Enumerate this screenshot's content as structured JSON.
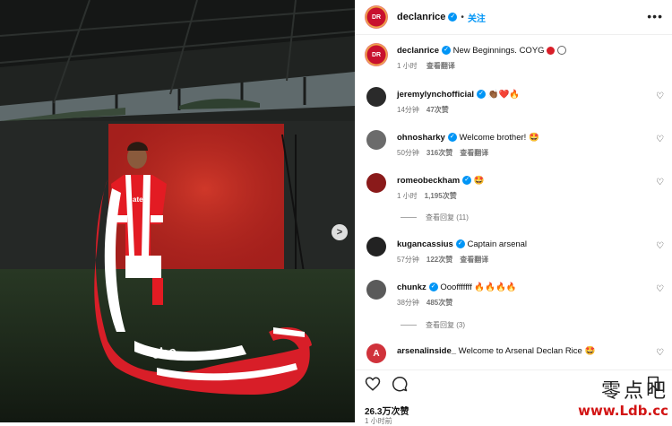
{
  "post": {
    "username": "declanrice",
    "follow_label": "关注",
    "dot": "•",
    "caption_text": "New Beginnings. COYG",
    "caption_time": "1 小时",
    "see_translation": "查看翻译",
    "avatar_text": "DR",
    "likes": "26.3万次赞",
    "posted_time": "1 小时前"
  },
  "comments": [
    {
      "user": "jeremylynchofficial",
      "text": "",
      "emoji": "👏🏾❤️🔥",
      "time": "14分钟",
      "likes": "47次赞",
      "action": "",
      "avatar_color": "#2a2a2a"
    },
    {
      "user": "ohnosharky",
      "text": "Welcome brother!",
      "emoji": "🤩",
      "time": "50分钟",
      "likes": "316次赞",
      "action": "查看翻译",
      "avatar_color": "#6b6b6b"
    },
    {
      "user": "romeobeckham",
      "text": "",
      "emoji": "🤩",
      "time": "1 小时",
      "likes": "1,195次赞",
      "action": "",
      "avatar_color": "#8a1a1a"
    },
    {
      "user": "kugancassius",
      "text": "Captain arsenal",
      "emoji": "",
      "time": "57分钟",
      "likes": "122次赞",
      "action": "查看翻译",
      "avatar_color": "#222222"
    },
    {
      "user": "chunkz",
      "text": "Ooofffffff",
      "emoji": "🔥🔥🔥🔥",
      "time": "38分钟",
      "likes": "485次赞",
      "action": "",
      "avatar_color": "#5a5a5a"
    },
    {
      "user": "arsenalinside_",
      "text": "Welcome to Arsenal Declan Rice",
      "emoji": "🤩",
      "time": "",
      "likes": "",
      "action": "",
      "avatar_color": "#d0323b"
    }
  ],
  "replies": [
    {
      "label": "查看回复 (11)"
    },
    {
      "label": "查看回复 (3)"
    }
  ],
  "icons": {
    "more": "more-options-icon",
    "like": "heart-icon",
    "comment": "comment-icon",
    "save": "bookmark-icon",
    "next": "chevron-right-icon"
  },
  "colors": {
    "accent": "#0095f6",
    "arsenal_red": "#d81e28"
  },
  "watermark": {
    "chinese": "零点吧",
    "url": "www.Ldb.cc"
  }
}
